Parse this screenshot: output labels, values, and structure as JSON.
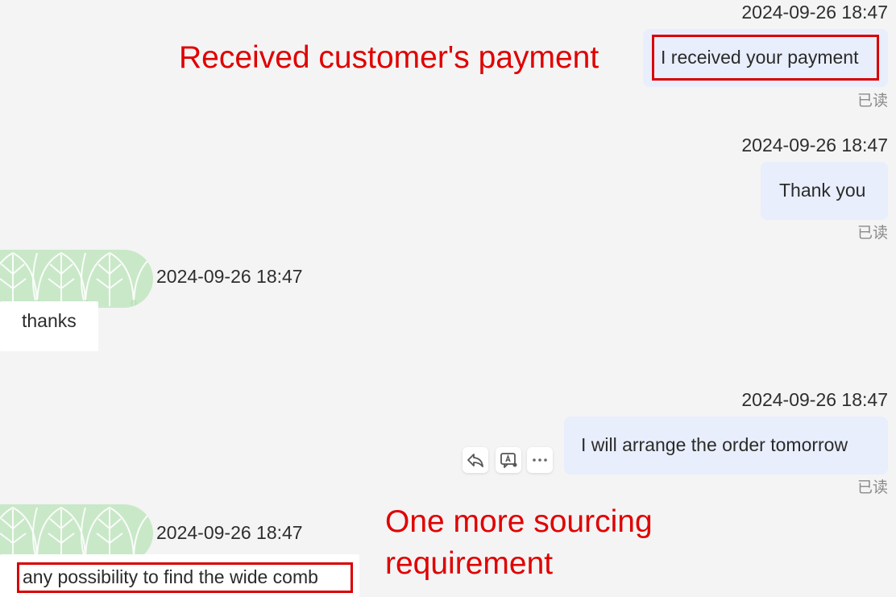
{
  "annotations": {
    "payment": "Received customer's payment",
    "sourcing_line1": "One more sourcing",
    "sourcing_line2": "requirement"
  },
  "read_label": "已读",
  "messages": [
    {
      "direction": "outgoing",
      "timestamp": "2024-09-26 18:47",
      "text": "I received your payment",
      "status": "已读"
    },
    {
      "direction": "outgoing",
      "timestamp": "2024-09-26 18:47",
      "text": "Thank you",
      "status": "已读"
    },
    {
      "direction": "incoming",
      "timestamp": "2024-09-26 18:47",
      "text": "thanks"
    },
    {
      "direction": "outgoing",
      "timestamp": "2024-09-26 18:47",
      "text": "I will arrange the order tomorrow",
      "status": "已读"
    },
    {
      "direction": "incoming",
      "timestamp": "2024-09-26 18:47",
      "text": "any possibility to find the wide comb"
    }
  ],
  "message_actions": [
    "reply-icon",
    "translate-icon",
    "more-icon"
  ],
  "colors": {
    "annotation_red": "#e00000",
    "outgoing_bubble": "#e8eefb",
    "incoming_bubble": "#ffffff",
    "avatar_green": "#c9e8c8",
    "background": "#f4f4f4"
  }
}
